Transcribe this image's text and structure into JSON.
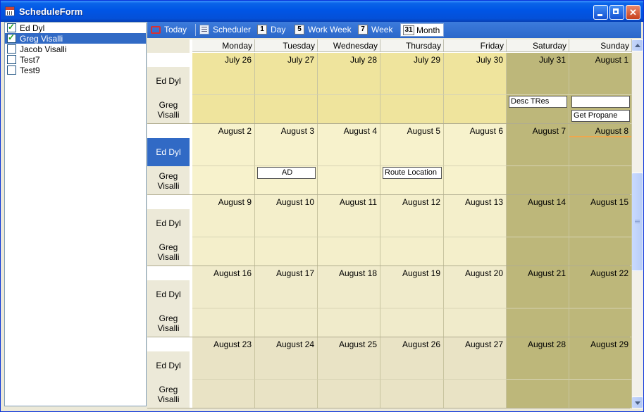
{
  "window": {
    "title": "ScheduleForm"
  },
  "resources": [
    {
      "name": "Ed Dyl",
      "checked": true,
      "selected": false
    },
    {
      "name": "Greg Visalli",
      "checked": true,
      "selected": true
    },
    {
      "name": "Jacob Visalli",
      "checked": false,
      "selected": false
    },
    {
      "name": "Test7",
      "checked": false,
      "selected": false
    },
    {
      "name": "Test9",
      "checked": false,
      "selected": false
    }
  ],
  "toolbar": {
    "today": "Today",
    "scheduler": "Scheduler",
    "day": "Day",
    "work_week": "Work Week",
    "week": "Week",
    "month": "Month",
    "day_icon": "1",
    "work_week_icon": "5",
    "week_icon": "7",
    "month_icon": "31"
  },
  "calendar": {
    "days": [
      "Monday",
      "Tuesday",
      "Wednesday",
      "Thursday",
      "Friday",
      "Saturday",
      "Sunday"
    ],
    "row_resources": [
      "Ed Dyl",
      "Greg\nVisalli"
    ],
    "weeks": [
      {
        "dates": [
          "July 26",
          "July 27",
          "July 28",
          "July 29",
          "July 30",
          "July 31",
          "August 1"
        ],
        "appointments": [
          {
            "resource": 1,
            "day": 5,
            "slot": 0,
            "text": "Desc TRes"
          },
          {
            "resource": 1,
            "day": 6,
            "slot": 0,
            "text": ""
          },
          {
            "resource": 1,
            "day": 6,
            "slot": 1,
            "text": "Get Propane"
          }
        ]
      },
      {
        "dates": [
          "August 2",
          "August 3",
          "August 4",
          "August 5",
          "August 6",
          "August 7",
          "August 8"
        ],
        "appointments": [
          {
            "resource": 1,
            "day": 1,
            "slot": 0,
            "text": "AD",
            "center": true
          },
          {
            "resource": 1,
            "day": 3,
            "slot": 0,
            "text": "Route Location"
          }
        ]
      },
      {
        "dates": [
          "August 9",
          "August 10",
          "August 11",
          "August 12",
          "August 13",
          "August 14",
          "August 15"
        ],
        "appointments": []
      },
      {
        "dates": [
          "August 16",
          "August 17",
          "August 18",
          "August 19",
          "August 20",
          "August 21",
          "August 22"
        ],
        "appointments": []
      },
      {
        "dates": [
          "August 23",
          "August 24",
          "August 25",
          "August 26",
          "August 27",
          "August 28",
          "August 29"
        ],
        "appointments": []
      }
    ],
    "today": {
      "week": 1,
      "day": 6
    },
    "selected_row_header": {
      "week": 1,
      "resource": 0
    },
    "colors": {
      "month_current": "#efe49d",
      "weekday": "#f7f2cc",
      "weekend": "#bdb77a",
      "selection": "#316ac5"
    }
  }
}
